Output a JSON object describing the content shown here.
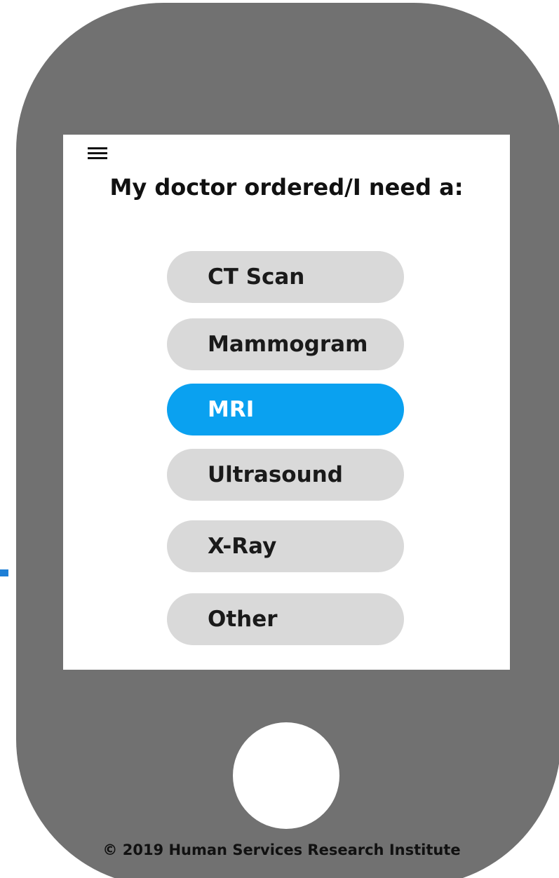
{
  "screen": {
    "prompt": "My doctor ordered/I need a:",
    "menu_icon": "hamburger-menu-icon",
    "options": [
      {
        "label": "CT Scan",
        "selected": false
      },
      {
        "label": "Mammogram",
        "selected": false
      },
      {
        "label": "MRI",
        "selected": true
      },
      {
        "label": "Ultrasound",
        "selected": false
      },
      {
        "label": "X-Ray",
        "selected": false
      },
      {
        "label": "Other",
        "selected": false
      }
    ]
  },
  "footer": {
    "copyright": "© 2019 Human Services Research Institute"
  },
  "colors": {
    "phone_body": "#717171",
    "selected_option": "#0aa1f0",
    "unselected_option": "#d9d9d9",
    "screen_background": "#ffffff"
  }
}
